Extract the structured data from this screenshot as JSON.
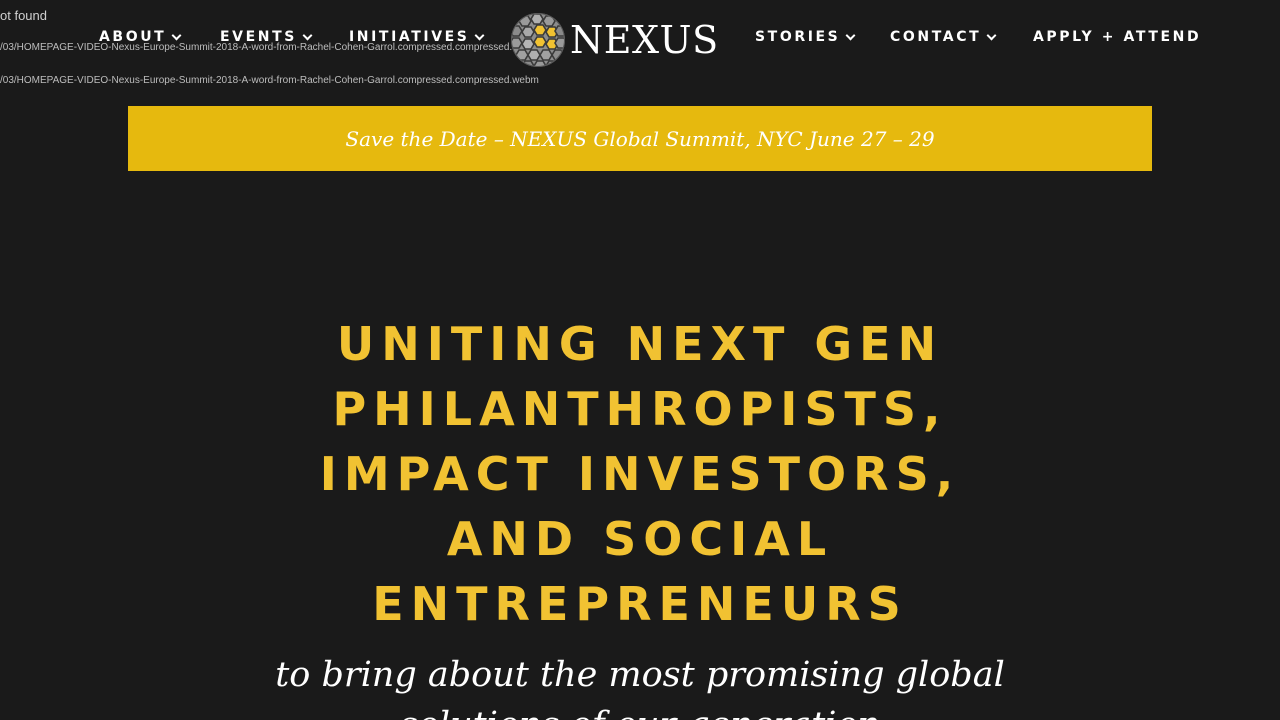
{
  "debug": {
    "line1": "ot found",
    "line2": "/03/HOMEPAGE-VIDEO-Nexus-Europe-Summit-2018-A-word-from-Rachel-Cohen-Garrol.compressed.compressed.mp4",
    "line3": "/03/HOMEPAGE-VIDEO-Nexus-Europe-Summit-2018-A-word-from-Rachel-Cohen-Garrol.compressed.compressed.webm"
  },
  "nav": {
    "about": "ABOUT",
    "events": "EVENTS",
    "initiatives": "INITIATIVES",
    "stories": "STORIES",
    "contact": "CONTACT",
    "apply": "APPLY + ATTEND"
  },
  "logo": {
    "text": "NEXUS",
    "icon": "honeycomb-globe-icon"
  },
  "banner": {
    "text": "Save the Date – NEXUS Global Summit, NYC June 27 – 29"
  },
  "hero": {
    "lines": [
      "UNITING NEXT GEN",
      "PHILANTHROPISTS,",
      "IMPACT INVESTORS,",
      "AND SOCIAL",
      "ENTREPRENEURS"
    ],
    "subhead": "to bring about the most promising global solutions of our generation"
  },
  "colors": {
    "background": "#1a1a1a",
    "banner": "#e6b90e",
    "hero_text": "#f1c232",
    "nav_text": "#ffffff"
  }
}
